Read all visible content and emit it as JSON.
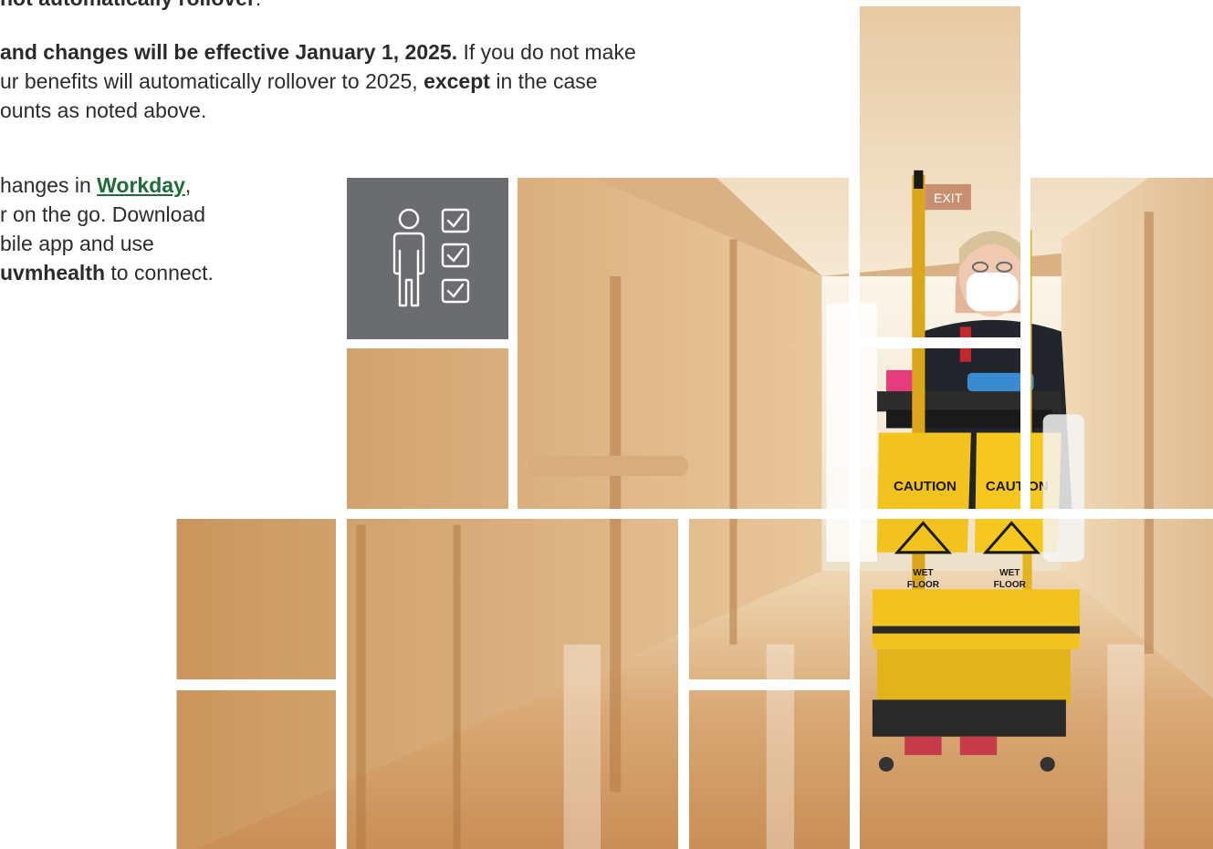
{
  "doc": {
    "line0": {
      "bold": "not automatically rollover",
      "after": "."
    },
    "para1": [
      {
        "bold": "and changes will be effective January 1, 2025.",
        "after": " If you do not make"
      },
      {
        "before": "ur benefits will automatically rollover to 2025, ",
        "bold": "except",
        "after": " in the case"
      },
      {
        "before": "ounts as noted above."
      }
    ],
    "para2": [
      {
        "before": "hanges in ",
        "link": "Workday",
        "after": ","
      },
      {
        "before": "r on the go. Download"
      },
      {
        "before": "bile app and use"
      },
      {
        "bold": "uvmhealth",
        "after": " to connect."
      }
    ]
  },
  "icons": {
    "tile_icon": "person-checklist-icon"
  },
  "colors": {
    "link": "#1f6b3a",
    "icon_tile": "#6a6c70",
    "text": "#2b2b2b"
  },
  "photo": {
    "sign_caution_left": "CAUTION",
    "sign_caution_right": "CAUTION",
    "sign_wet_floor": "WET FLOOR",
    "sign_exit": "EXIT"
  }
}
